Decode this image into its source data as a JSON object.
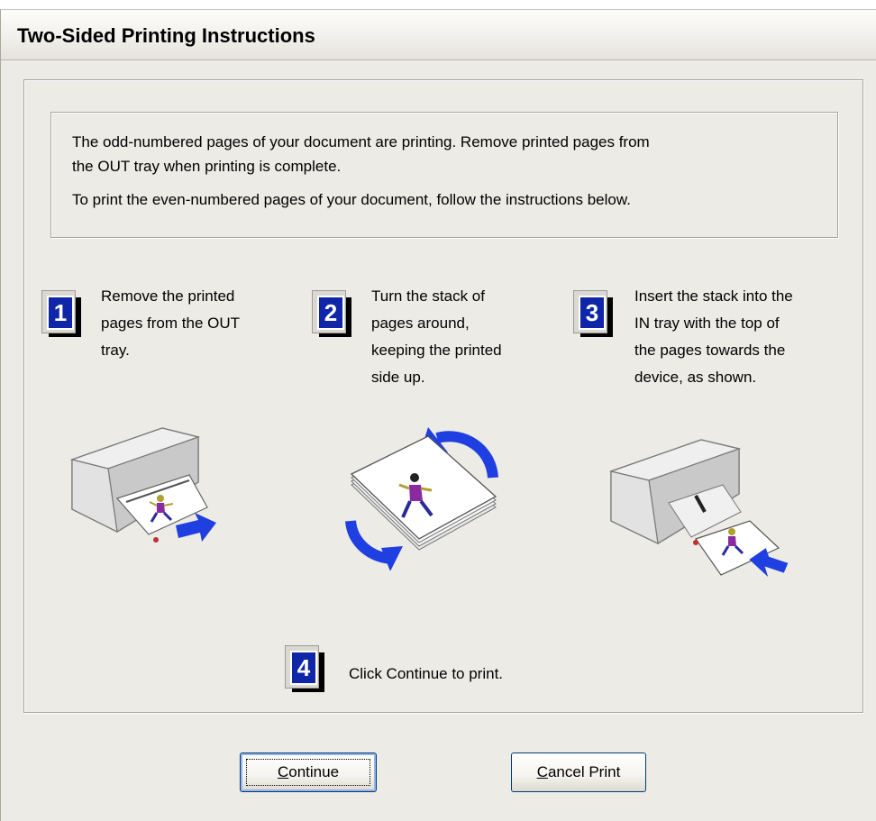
{
  "window": {
    "title": "Two-Sided Printing Instructions"
  },
  "message": {
    "line1": "The odd-numbered pages of your document are printing.  Remove printed pages from",
    "line2": "the OUT tray when printing is complete.",
    "line3": "To print the even-numbered pages of your document, follow the instructions below."
  },
  "steps": [
    {
      "number": "1",
      "lines": [
        "Remove the printed",
        "pages from the OUT",
        "tray."
      ]
    },
    {
      "number": "2",
      "lines": [
        "Turn the stack of",
        "pages around,",
        "keeping the printed",
        "side up."
      ]
    },
    {
      "number": "3",
      "lines": [
        "Insert the stack into the",
        "IN tray with the top of",
        "the pages towards the",
        "device, as shown."
      ]
    },
    {
      "number": "4",
      "lines": [
        "Click Continue to print."
      ]
    }
  ],
  "buttons": {
    "continue": {
      "mnemonic": "C",
      "rest": "ontinue"
    },
    "cancel": {
      "mnemonic": "C",
      "rest": "ancel Print"
    }
  },
  "colors": {
    "badge_blue": "#0f26a8",
    "arrow_blue": "#1f3fe0",
    "dialog_bg": "#ecebe6"
  }
}
